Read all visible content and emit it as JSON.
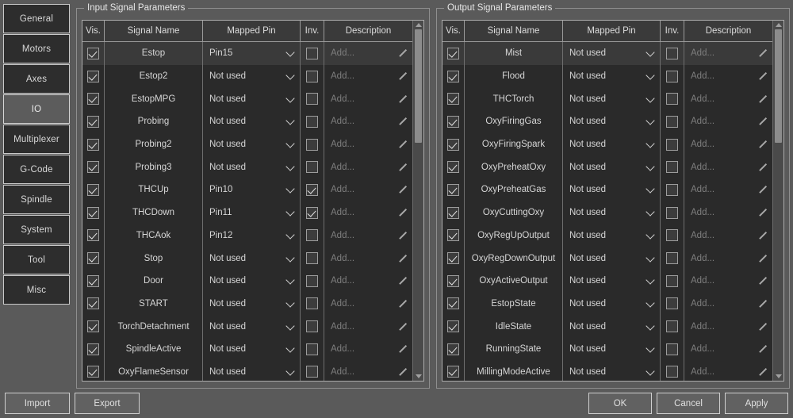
{
  "sidebar": {
    "items": [
      {
        "label": "General",
        "active": false
      },
      {
        "label": "Motors",
        "active": false
      },
      {
        "label": "Axes",
        "active": false
      },
      {
        "label": "IO",
        "active": true
      },
      {
        "label": "Multiplexer",
        "active": false
      },
      {
        "label": "G-Code",
        "active": false
      },
      {
        "label": "Spindle",
        "active": false
      },
      {
        "label": "System",
        "active": false
      },
      {
        "label": "Tool",
        "active": false
      },
      {
        "label": "Misc",
        "active": false
      }
    ]
  },
  "input_panel": {
    "title": "Input Signal Parameters",
    "columns": [
      "Vis.",
      "Signal Name",
      "Mapped Pin",
      "Inv.",
      "Description"
    ],
    "description_placeholder": "Add...",
    "scroll_thumb_percent": 33,
    "rows": [
      {
        "visible": true,
        "name": "Estop",
        "pin": "Pin15",
        "inverted": false,
        "description": "",
        "selected": true
      },
      {
        "visible": true,
        "name": "Estop2",
        "pin": "Not used",
        "inverted": false,
        "description": "",
        "selected": false
      },
      {
        "visible": true,
        "name": "EstopMPG",
        "pin": "Not used",
        "inverted": false,
        "description": "",
        "selected": false
      },
      {
        "visible": true,
        "name": "Probing",
        "pin": "Not used",
        "inverted": false,
        "description": "",
        "selected": false
      },
      {
        "visible": true,
        "name": "Probing2",
        "pin": "Not used",
        "inverted": false,
        "description": "",
        "selected": false
      },
      {
        "visible": true,
        "name": "Probing3",
        "pin": "Not used",
        "inverted": false,
        "description": "",
        "selected": false
      },
      {
        "visible": true,
        "name": "THCUp",
        "pin": "Pin10",
        "inverted": true,
        "description": "",
        "selected": false
      },
      {
        "visible": true,
        "name": "THCDown",
        "pin": "Pin11",
        "inverted": true,
        "description": "",
        "selected": false
      },
      {
        "visible": true,
        "name": "THCAok",
        "pin": "Pin12",
        "inverted": false,
        "description": "",
        "selected": false
      },
      {
        "visible": true,
        "name": "Stop",
        "pin": "Not used",
        "inverted": false,
        "description": "",
        "selected": false
      },
      {
        "visible": true,
        "name": "Door",
        "pin": "Not used",
        "inverted": false,
        "description": "",
        "selected": false
      },
      {
        "visible": true,
        "name": "START",
        "pin": "Not used",
        "inverted": false,
        "description": "",
        "selected": false
      },
      {
        "visible": true,
        "name": "TorchDetachment",
        "pin": "Not used",
        "inverted": false,
        "description": "",
        "selected": false
      },
      {
        "visible": true,
        "name": "SpindleActive",
        "pin": "Not used",
        "inverted": false,
        "description": "",
        "selected": false
      },
      {
        "visible": true,
        "name": "OxyFlameSensor",
        "pin": "Not used",
        "inverted": false,
        "description": "",
        "selected": false
      }
    ]
  },
  "output_panel": {
    "title": "Output Signal Parameters",
    "columns": [
      "Vis.",
      "Signal Name",
      "Mapped Pin",
      "Inv.",
      "Description"
    ],
    "description_placeholder": "Add...",
    "scroll_thumb_percent": 33,
    "rows": [
      {
        "visible": true,
        "name": "Mist",
        "pin": "Not used",
        "inverted": false,
        "description": "",
        "selected": true
      },
      {
        "visible": true,
        "name": "Flood",
        "pin": "Not used",
        "inverted": false,
        "description": "",
        "selected": false
      },
      {
        "visible": true,
        "name": "THCTorch",
        "pin": "Not used",
        "inverted": false,
        "description": "",
        "selected": false
      },
      {
        "visible": true,
        "name": "OxyFiringGas",
        "pin": "Not used",
        "inverted": false,
        "description": "",
        "selected": false
      },
      {
        "visible": true,
        "name": "OxyFiringSpark",
        "pin": "Not used",
        "inverted": false,
        "description": "",
        "selected": false
      },
      {
        "visible": true,
        "name": "OxyPreheatOxy",
        "pin": "Not used",
        "inverted": false,
        "description": "",
        "selected": false
      },
      {
        "visible": true,
        "name": "OxyPreheatGas",
        "pin": "Not used",
        "inverted": false,
        "description": "",
        "selected": false
      },
      {
        "visible": true,
        "name": "OxyCuttingOxy",
        "pin": "Not used",
        "inverted": false,
        "description": "",
        "selected": false
      },
      {
        "visible": true,
        "name": "OxyRegUpOutput",
        "pin": "Not used",
        "inverted": false,
        "description": "",
        "selected": false
      },
      {
        "visible": true,
        "name": "OxyRegDownOutput",
        "pin": "Not used",
        "inverted": false,
        "description": "",
        "selected": false
      },
      {
        "visible": true,
        "name": "OxyActiveOutput",
        "pin": "Not used",
        "inverted": false,
        "description": "",
        "selected": false
      },
      {
        "visible": true,
        "name": "EstopState",
        "pin": "Not used",
        "inverted": false,
        "description": "",
        "selected": false
      },
      {
        "visible": true,
        "name": "IdleState",
        "pin": "Not used",
        "inverted": false,
        "description": "",
        "selected": false
      },
      {
        "visible": true,
        "name": "RunningState",
        "pin": "Not used",
        "inverted": false,
        "description": "",
        "selected": false
      },
      {
        "visible": true,
        "name": "MillingModeActive",
        "pin": "Not used",
        "inverted": false,
        "description": "",
        "selected": false
      }
    ]
  },
  "footer": {
    "import_label": "Import",
    "export_label": "Export",
    "ok_label": "OK",
    "cancel_label": "Cancel",
    "apply_label": "Apply"
  },
  "colors": {
    "window_bg": "#5a5a5a",
    "table_bg": "#2a2a2a",
    "row_alt_bg": "#3a3a3a",
    "nav_bg": "#2d2d2d",
    "nav_active_bg": "#5c5c5c",
    "text": "#d6d6d6",
    "placeholder": "#7e7e7e",
    "border": "#adadad"
  }
}
